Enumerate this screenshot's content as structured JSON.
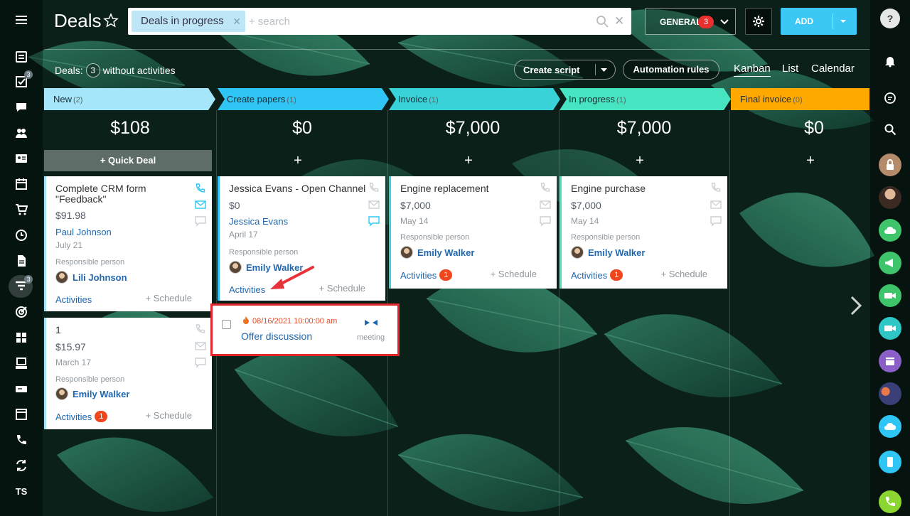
{
  "header": {
    "title": "Deals",
    "filter_chip": "Deals in progress",
    "search_placeholder": "+ search",
    "general_label": "GENERAL",
    "general_count": "3",
    "add_label": "ADD"
  },
  "toolbar": {
    "deals_label": "Deals:",
    "deals_count": "3",
    "deals_suffix": "without activities",
    "create_script": "Create script",
    "automation_rules": "Automation rules",
    "views": [
      "Kanban",
      "List",
      "Calendar"
    ]
  },
  "left_sidebar": {
    "badges": {
      "tasks": "3",
      "filter": "3"
    },
    "bottom_text": "TS"
  },
  "columns": [
    {
      "name": "New",
      "count": "(2)",
      "total": "$108",
      "color": "#a5e6fa"
    },
    {
      "name": "Create papers",
      "count": "(1)",
      "total": "$0",
      "color": "#2fc6f6"
    },
    {
      "name": "Invoice",
      "count": "(1)",
      "total": "$7,000",
      "color": "#39d2d9"
    },
    {
      "name": "In progress",
      "count": "(1)",
      "total": "$7,000",
      "color": "#47e4c2"
    },
    {
      "name": "Final invoice",
      "count": "(0)",
      "total": "$0",
      "color": "#ffa900"
    }
  ],
  "quick_deal": "+ Quick Deal",
  "add_plus": "+",
  "cards": {
    "c1": {
      "title": "Complete CRM form \"Feedback\"",
      "amount": "$91.98",
      "client": "Paul Johnson",
      "date": "July 21",
      "resp_label": "Responsible person",
      "resp": "Lili Johnson",
      "activities": "Activities",
      "schedule": "+ Schedule"
    },
    "c2": {
      "title": "1",
      "amount": "$15.97",
      "date": "March 17",
      "resp_label": "Responsible person",
      "resp": "Emily Walker",
      "activities": "Activities",
      "activities_count": "1",
      "schedule": "+ Schedule"
    },
    "c3": {
      "title": "Jessica Evans - Open Channel",
      "amount": "$0",
      "client": "Jessica Evans",
      "date": "April 17",
      "resp_label": "Responsible person",
      "resp": "Emily Walker",
      "activities": "Activities",
      "schedule": "+ Schedule"
    },
    "c4": {
      "title": "Engine replacement",
      "amount": "$7,000",
      "date": "May 14",
      "resp_label": "Responsible person",
      "resp": "Emily Walker",
      "activities": "Activities",
      "activities_count": "1",
      "schedule": "+ Schedule"
    },
    "c5": {
      "title": "Engine purchase",
      "amount": "$7,000",
      "date": "May 14",
      "resp_label": "Responsible person",
      "resp": "Emily Walker",
      "activities": "Activities",
      "activities_count": "1",
      "schedule": "+ Schedule"
    }
  },
  "activity_popup": {
    "datetime": "08/16/2021 10:00:00 am",
    "title": "Offer discussion",
    "type": "meeting"
  },
  "colors": {
    "accent": "#3bc8f5",
    "link": "#2067b0",
    "alert": "#e3252d"
  }
}
